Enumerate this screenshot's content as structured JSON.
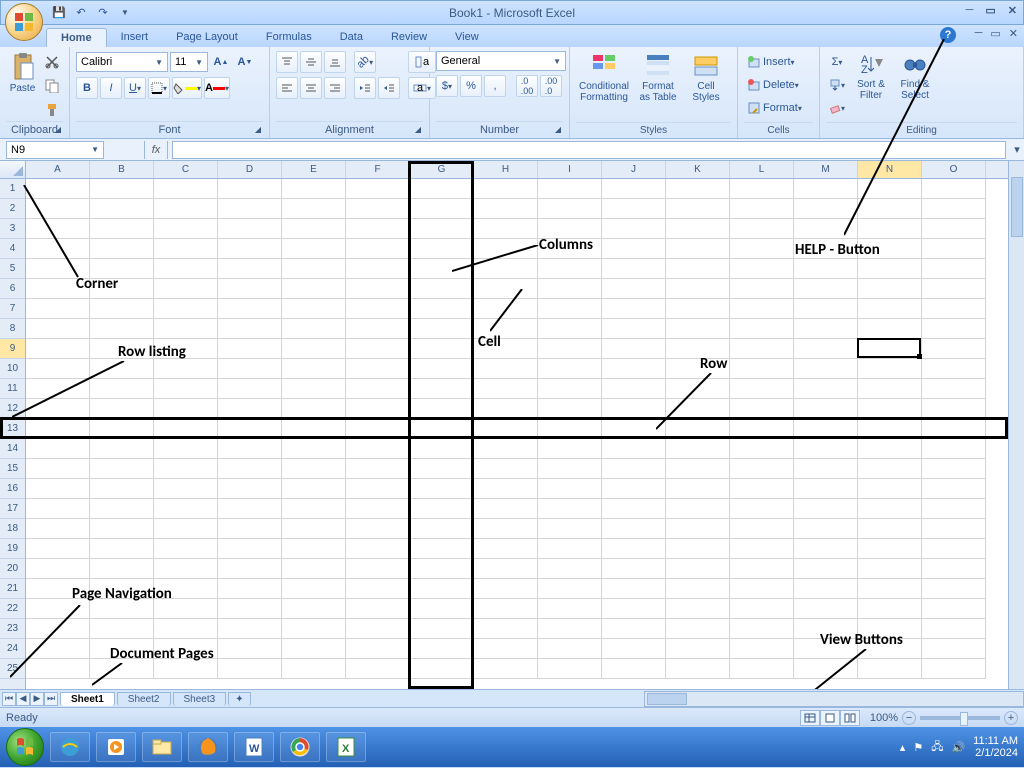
{
  "title": "Book1 - Microsoft Excel",
  "qat": {
    "save": "💾",
    "undo": "↶",
    "redo": "↷"
  },
  "tabs": [
    "Home",
    "Insert",
    "Page Layout",
    "Formulas",
    "Data",
    "Review",
    "View"
  ],
  "activeTab": 0,
  "ribbon": {
    "clipboard": {
      "label": "Clipboard",
      "paste": "Paste"
    },
    "font": {
      "label": "Font",
      "name": "Calibri",
      "size": "11"
    },
    "alignment": {
      "label": "Alignment"
    },
    "number": {
      "label": "Number",
      "format": "General"
    },
    "styles": {
      "label": "Styles",
      "cond": "Conditional\nFormatting",
      "table": "Format\nas Table",
      "cell": "Cell\nStyles"
    },
    "cells": {
      "label": "Cells",
      "insert": "Insert",
      "delete": "Delete",
      "format": "Format"
    },
    "editing": {
      "label": "Editing",
      "sort": "Sort &\nFilter",
      "find": "Find &\nSelect"
    }
  },
  "namebox": "N9",
  "columns": [
    "A",
    "B",
    "C",
    "D",
    "E",
    "F",
    "G",
    "H",
    "I",
    "J",
    "K",
    "L",
    "M",
    "N",
    "O"
  ],
  "rows": 25,
  "activeCell": {
    "col": 13,
    "row": 8
  },
  "selectedRowHdr": 9,
  "selectedColHdr": "N",
  "highlightCol": 6,
  "highlightRow": 12,
  "sheets": [
    "Sheet1",
    "Sheet2",
    "Sheet3"
  ],
  "activeSheet": 0,
  "status": {
    "ready": "Ready",
    "zoom": "100%"
  },
  "annotations": {
    "corner": "Corner",
    "rowlisting": "Row listing",
    "pagenav": "Page Navigation",
    "docpages": "Document Pages",
    "columns": "Columns",
    "cell": "Cell",
    "row": "Row",
    "help": "HELP - Button",
    "view": "View Buttons"
  },
  "tray": {
    "time": "11:11 AM",
    "date": "2/1/2024"
  }
}
